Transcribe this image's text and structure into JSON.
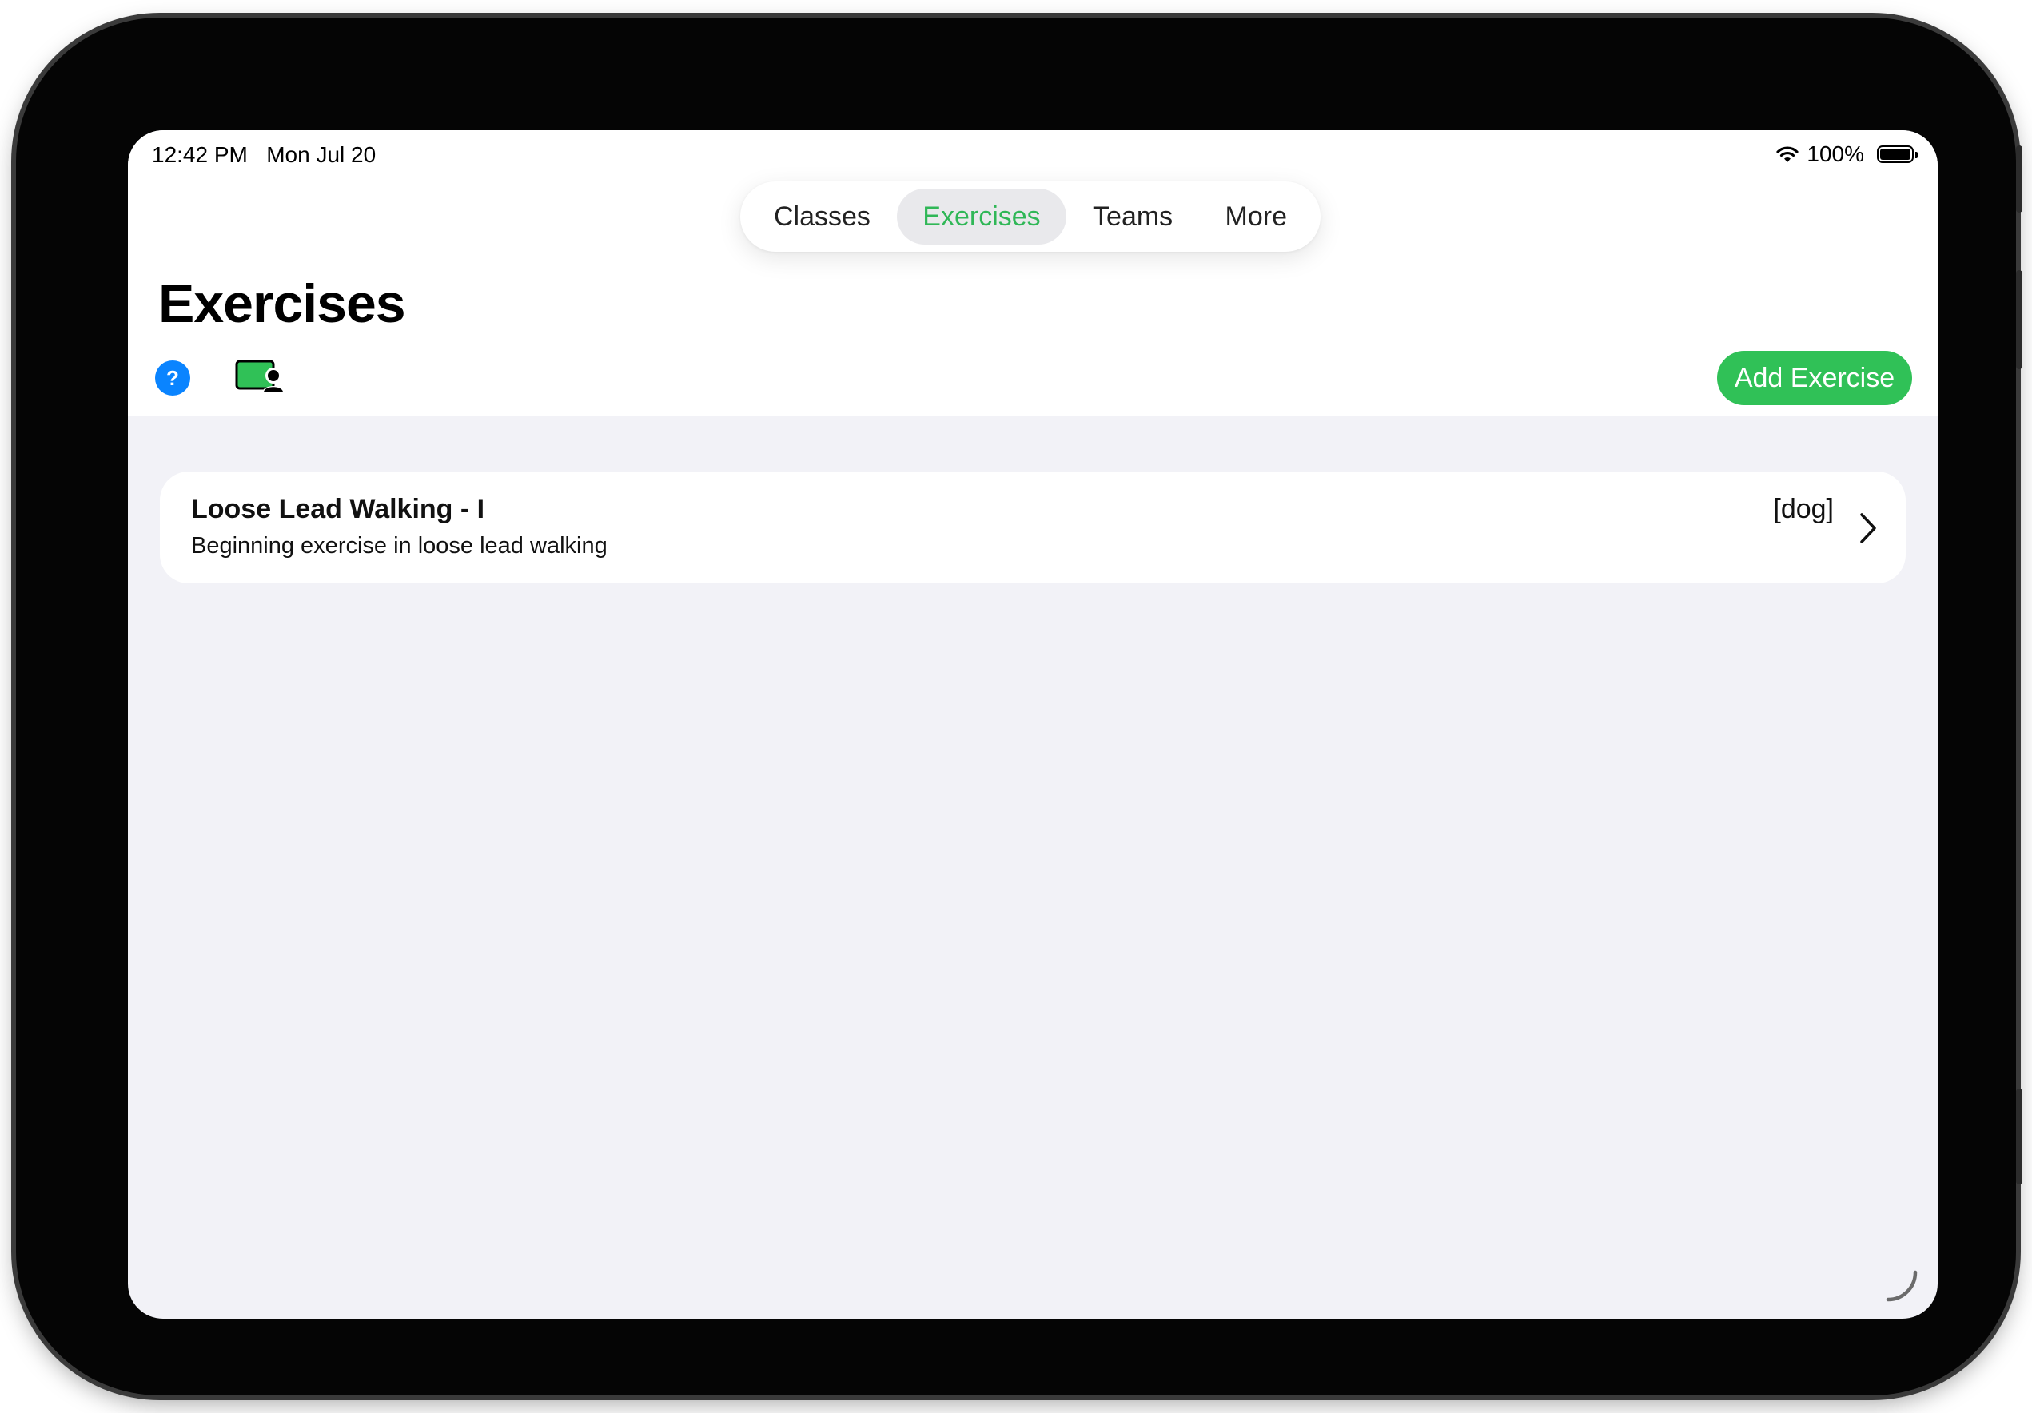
{
  "status_bar": {
    "time": "12:42 PM",
    "date": "Mon Jul 20",
    "battery": "100%",
    "icons": [
      "wifi-icon",
      "battery-icon"
    ]
  },
  "tabs": [
    {
      "label": "Classes",
      "active": false
    },
    {
      "label": "Exercises",
      "active": true
    },
    {
      "label": "Teams",
      "active": false
    },
    {
      "label": "More",
      "active": false
    }
  ],
  "page": {
    "title": "Exercises",
    "add_button_label": "Add Exercise",
    "icons": [
      "help-icon",
      "presenter-icon"
    ]
  },
  "exercises": [
    {
      "title": "Loose Lead Walking - I",
      "description": "Beginning exercise in loose lead walking",
      "tag": "[dog]"
    }
  ],
  "colors": {
    "accent": "#30c157",
    "active_tab_text": "#30b757",
    "help_icon": "#0a84ff",
    "background": "#f2f2f7"
  }
}
